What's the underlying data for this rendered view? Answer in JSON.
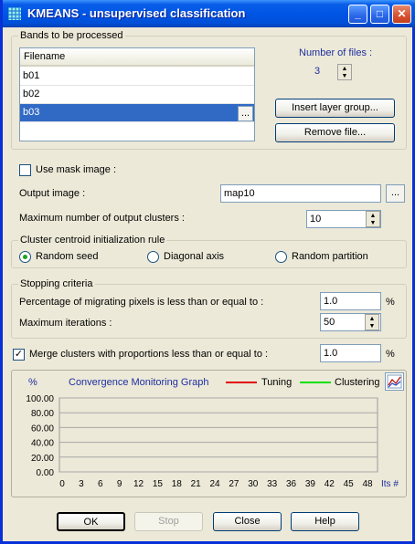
{
  "window": {
    "title": "KMEANS - unsupervised classification",
    "min": "_",
    "max": "□",
    "close": "✕"
  },
  "bands": {
    "group_label": "Bands to be processed",
    "column_header": "Filename",
    "files": [
      "b01",
      "b02",
      "b03"
    ],
    "ellipsis": "...",
    "number_label": "Number of files :",
    "number_value": "3",
    "insert_button": "Insert layer group...",
    "remove_button": "Remove file..."
  },
  "mask": {
    "label": "Use mask image :",
    "checked": false
  },
  "output": {
    "label": "Output image :",
    "value": "map10",
    "ellipsis": "..."
  },
  "max_clusters": {
    "label": "Maximum number of output clusters :",
    "value": "10"
  },
  "init_rule": {
    "group_label": "Cluster centroid initialization rule",
    "options": [
      "Random seed",
      "Diagonal axis",
      "Random partition"
    ],
    "selected": "Random seed"
  },
  "stopping": {
    "group_label": "Stopping criteria",
    "migrating_label": "Percentage of migrating pixels is less than or equal to :",
    "migrating_value": "1.0",
    "migrating_unit": "%",
    "iterations_label": "Maximum iterations :",
    "iterations_value": "50"
  },
  "merge": {
    "label": "Merge clusters with proportions less than or equal to :",
    "checked": true,
    "value": "1.0",
    "unit": "%"
  },
  "graph": {
    "unit": "%",
    "title": "Convergence Monitoring Graph",
    "legend": [
      {
        "name": "Tuning",
        "color": "#E00000"
      },
      {
        "name": "Clustering",
        "color": "#00E000"
      }
    ],
    "y_ticks": [
      "100.00",
      "80.00",
      "60.00",
      "40.00",
      "20.00",
      "0.00"
    ],
    "x_ticks": [
      "0",
      "3",
      "6",
      "9",
      "12",
      "15",
      "18",
      "21",
      "24",
      "27",
      "30",
      "33",
      "36",
      "39",
      "42",
      "45",
      "48"
    ],
    "x_unit": "Its #",
    "icon": "chart-icon"
  },
  "buttons": {
    "ok": "OK",
    "stop": "Stop",
    "close": "Close",
    "help": "Help"
  }
}
